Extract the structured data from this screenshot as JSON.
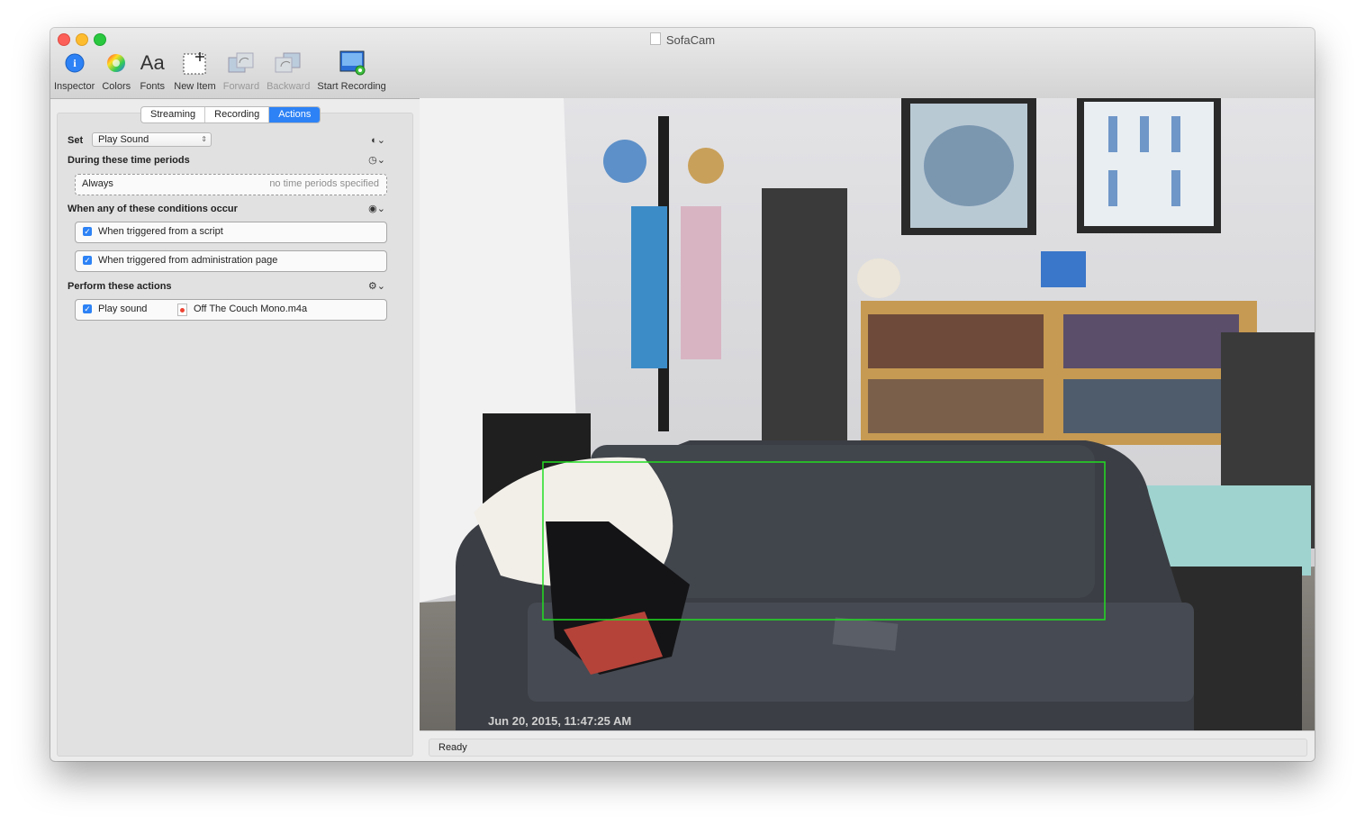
{
  "window": {
    "title": "SofaCam"
  },
  "toolbar": {
    "items": [
      {
        "label": "Inspector",
        "icon": "info-icon"
      },
      {
        "label": "Colors",
        "icon": "color-wheel-icon"
      },
      {
        "label": "Fonts",
        "icon": "fonts-icon"
      },
      {
        "label": "New Item",
        "icon": "new-item-icon"
      },
      {
        "label": "Forward",
        "icon": "bring-forward-icon",
        "disabled": true
      },
      {
        "label": "Backward",
        "icon": "send-backward-icon",
        "disabled": true
      },
      {
        "label": "Start Recording",
        "icon": "record-icon"
      }
    ]
  },
  "sidebar": {
    "tabs": [
      {
        "label": "Streaming",
        "active": false
      },
      {
        "label": "Recording",
        "active": false
      },
      {
        "label": "Actions",
        "active": true
      }
    ],
    "set_label": "Set",
    "set_value": "Play Sound",
    "time_section": {
      "title": "During these time periods",
      "value": "Always",
      "hint": "no time periods specified"
    },
    "conditions_section": {
      "title": "When any of these conditions occur",
      "items": [
        {
          "label": "When triggered from a script",
          "checked": true
        },
        {
          "label": "When triggered from administration page",
          "checked": true
        }
      ]
    },
    "actions_section": {
      "title": "Perform these actions",
      "action_label": "Play sound",
      "file_name": "Off The Couch Mono.m4a",
      "checked": true
    }
  },
  "video": {
    "timestamp": "Jun 20, 2015, 11:47:25 AM",
    "detection_color": "#22dd22"
  },
  "status": {
    "text": "Ready"
  },
  "colors": {
    "accent": "#2d82f5"
  }
}
